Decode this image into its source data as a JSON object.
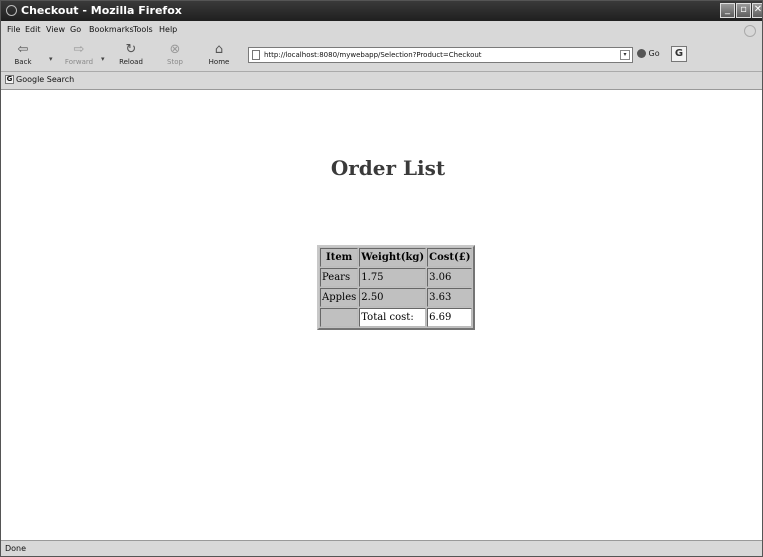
{
  "window": {
    "title": "Checkout - Mozilla Firefox"
  },
  "menu": [
    "File",
    "Edit",
    "View",
    "Go",
    "Bookmarks",
    "Tools",
    "Help"
  ],
  "toolbar": {
    "back": "Back",
    "forward": "Forward",
    "reload": "Reload",
    "stop": "Stop",
    "home": "Home",
    "url": "http://localhost:8080/mywebapp/Selection?Product=Checkout",
    "go": "Go"
  },
  "bookmarks": {
    "item": "Google Search"
  },
  "page": {
    "heading": "Order List",
    "table": {
      "headers": [
        "Item",
        "Weight(kg)",
        "Cost(£)"
      ],
      "rows": [
        [
          "Pears",
          "1.75",
          "3.06"
        ],
        [
          "Apples",
          "2.50",
          "3.63"
        ]
      ],
      "total_label": "Total cost:",
      "total_value": "6.69"
    }
  },
  "status": "Done"
}
